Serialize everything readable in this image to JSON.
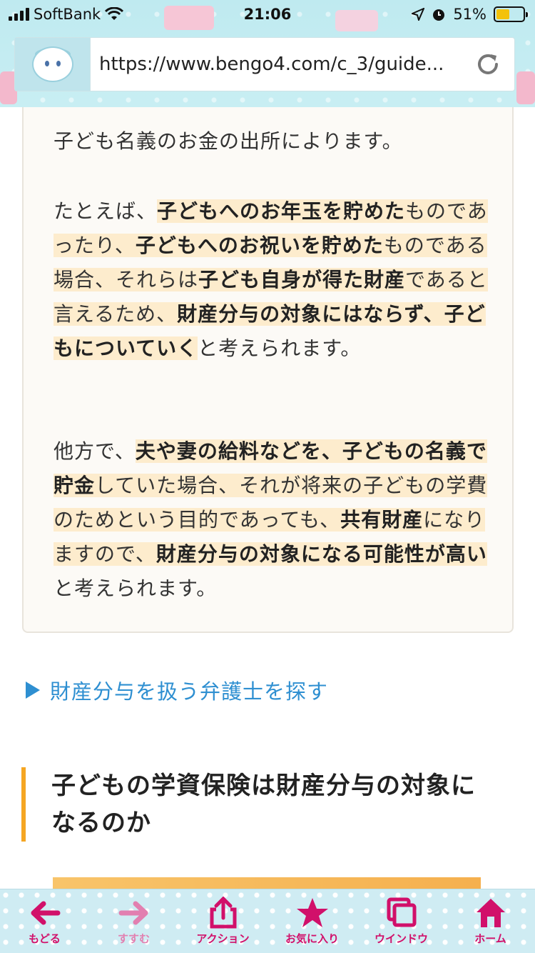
{
  "status_bar": {
    "carrier": "SoftBank",
    "time": "21:06",
    "battery": "51%"
  },
  "url_bar": {
    "url": "https://www.bengo4.com/c_3/guide..."
  },
  "article": {
    "p1": "子ども名義のお金の出所によります。",
    "p2": {
      "t1": "たとえば、",
      "b1": "子どもへのお年玉を貯めた",
      "t2": "もの",
      "t3": "であったり、",
      "b2": "子どもへのお祝いを貯めた",
      "t4": "も",
      "t5": "のである場合、それらは",
      "b3": "子ども自身が得た",
      "b4": "財産",
      "t6": "であると言えるため、",
      "b5": "財産分与の対象",
      "b6": "にはならず、子どもについていく",
      "t7": "と考えら",
      "t8": "れます。"
    },
    "p3": {
      "t1": "他方で、",
      "b1": "夫や妻の給料などを、子どもの名",
      "b2": "義で貯金",
      "t2": "していた場合、それが将来の子ど",
      "t3": "もの学費のためという目的であっても、",
      "b3": "共",
      "b4": "有財産",
      "t4": "になりますので、",
      "b5": "財産分与の対象に",
      "b6": "なる可能性が高い",
      "t5": "と考えられます。"
    }
  },
  "link": {
    "label": "財産分与を扱う弁護士を探す"
  },
  "section": {
    "title": "子どもの学資保険は財産分与の対象になるのか"
  },
  "toolbar": {
    "items": [
      {
        "label": "もどる",
        "icon": "arrow-left-icon"
      },
      {
        "label": "すすむ",
        "icon": "arrow-right-icon"
      },
      {
        "label": "アクション",
        "icon": "share-icon"
      },
      {
        "label": "お気に入り",
        "icon": "star-icon"
      },
      {
        "label": "ウインドウ",
        "icon": "windows-icon"
      },
      {
        "label": "ホーム",
        "icon": "home-icon"
      }
    ]
  },
  "colors": {
    "accent_pink": "#d1106a",
    "link_blue": "#2e8fd1",
    "highlight": "#fdeccd",
    "section_bar": "#f5a623"
  }
}
